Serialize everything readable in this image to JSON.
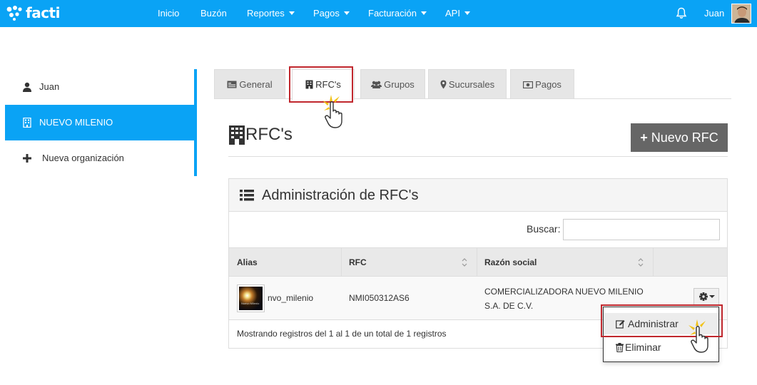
{
  "app": {
    "name": "facti"
  },
  "nav": {
    "items": [
      {
        "label": "Inicio",
        "dropdown": false
      },
      {
        "label": "Buzón",
        "dropdown": false
      },
      {
        "label": "Reportes",
        "dropdown": true
      },
      {
        "label": "Pagos",
        "dropdown": true
      },
      {
        "label": "Facturación",
        "dropdown": true
      },
      {
        "label": "API",
        "dropdown": true
      }
    ],
    "user_name": "Juan"
  },
  "sidebar": {
    "items": [
      {
        "label": "Juan",
        "icon": "user-icon",
        "active": false
      },
      {
        "label": "NUEVO MILENIO",
        "icon": "building-icon",
        "active": true
      },
      {
        "label": "Nueva organización",
        "icon": "plus-icon",
        "active": false
      }
    ]
  },
  "tabs": [
    {
      "label": "General",
      "icon": "id-card-icon",
      "active": false
    },
    {
      "label": "RFC's",
      "icon": "building-icon",
      "active": true
    },
    {
      "label": "Grupos",
      "icon": "users-icon",
      "active": false
    },
    {
      "label": "Sucursales",
      "icon": "map-marker-icon",
      "active": false
    },
    {
      "label": "Pagos",
      "icon": "money-icon",
      "active": false
    }
  ],
  "page": {
    "title": "RFC's",
    "new_button": "Nuevo RFC"
  },
  "panel": {
    "title": "Administración de RFC's",
    "search_label": "Buscar:",
    "search_value": "",
    "columns": [
      "Alias",
      "RFC",
      "Razón social"
    ],
    "rows": [
      {
        "alias": "nvo_milenio",
        "thumb_text": "Nuevo Milenio",
        "rfc": "NMI050312AS6",
        "razon_social_line1": "COMERCIALIZADORA NUEVO MILENIO",
        "razon_social_line2": "S.A. DE C.V."
      }
    ],
    "footer": "Mostrando registros del 1 al 1 de un total de 1 registros"
  },
  "row_menu": {
    "items": [
      {
        "label": "Administrar",
        "icon": "edit-icon"
      },
      {
        "label": "Eliminar",
        "icon": "trash-icon"
      }
    ]
  },
  "colors": {
    "brand": "#0aa3f5",
    "button": "#666666",
    "highlight": "#c0272d"
  }
}
